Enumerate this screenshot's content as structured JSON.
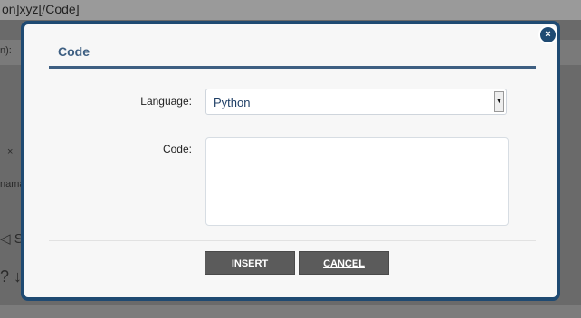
{
  "background": {
    "top_text": "on]xyz[/Code]",
    "left_labels": [
      "n):",
      "×",
      "nama",
      "◁ S",
      "? ↓"
    ]
  },
  "dialog": {
    "title": "Code",
    "close_label": "×",
    "fields": {
      "language_label": "Language:",
      "language_value": "Python",
      "code_label": "Code:",
      "code_value": ""
    },
    "buttons": {
      "insert": "INSERT",
      "cancel": "CANCEL"
    }
  },
  "colors": {
    "modal_border": "#1f4a72",
    "title_text": "#3e5f82",
    "button_bg": "#5b5b5b"
  },
  "icons": [
    "close-icon",
    "dropdown-arrow-icon"
  ]
}
